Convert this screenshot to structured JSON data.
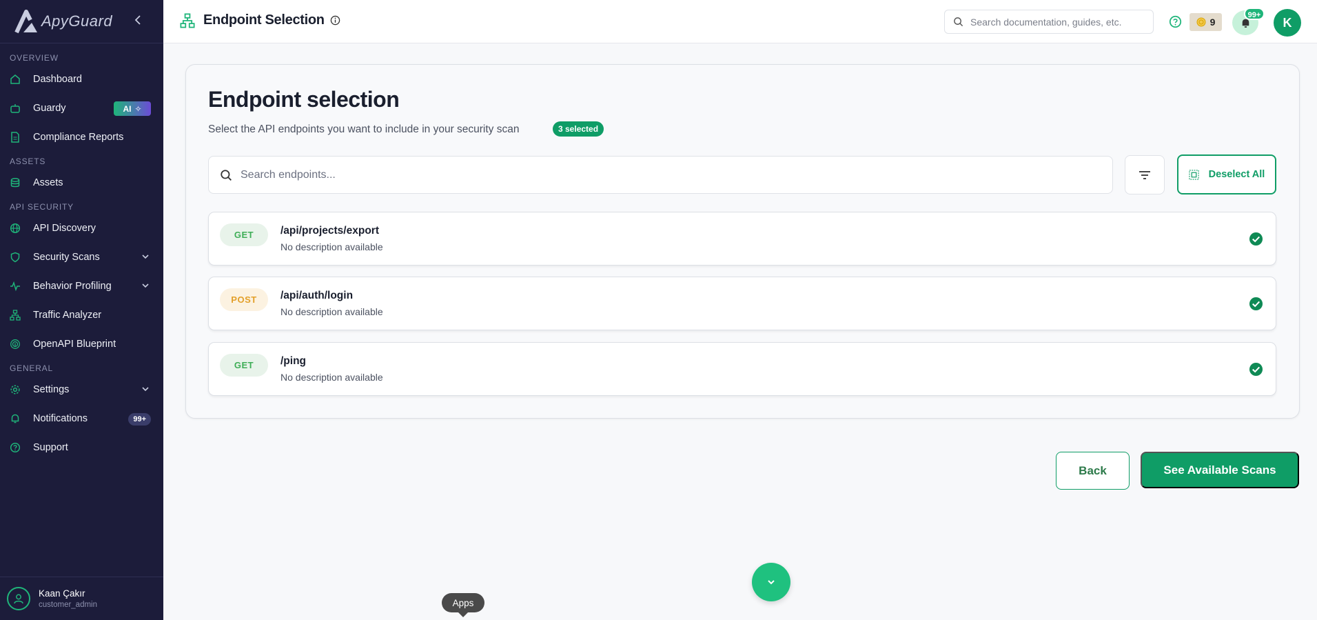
{
  "brand": {
    "name": "ApyGuard"
  },
  "sidebar": {
    "sections": {
      "overview": "OVERVIEW",
      "assets": "ASSETS",
      "api_security": "API SECURITY",
      "general": "GENERAL"
    },
    "items": {
      "dashboard": "Dashboard",
      "guardy": "Guardy",
      "guardy_badge": "AI",
      "compliance": "Compliance Reports",
      "assets": "Assets",
      "api_discovery": "API Discovery",
      "security_scans": "Security Scans",
      "behavior_profiling": "Behavior Profiling",
      "traffic_analyzer": "Traffic Analyzer",
      "openapi_blueprint": "OpenAPI Blueprint",
      "settings": "Settings",
      "notifications": "Notifications",
      "notifications_badge": "99+",
      "support": "Support"
    },
    "user": {
      "name": "Kaan Çakır",
      "role": "customer_admin"
    }
  },
  "header": {
    "title": "Endpoint Selection",
    "search_placeholder": "Search documentation, guides, etc.",
    "credits": "9",
    "notification_badge": "99+",
    "avatar_initial": "K"
  },
  "main": {
    "title": "Endpoint selection",
    "subtitle": "Select the API endpoints you want to include in your security scan",
    "selected_badge": "3 selected",
    "search_placeholder": "Search endpoints...",
    "deselect_label": "Deselect All",
    "endpoints": [
      {
        "method": "GET",
        "path": "/api/projects/export",
        "description": "No description available",
        "selected": true
      },
      {
        "method": "POST",
        "path": "/api/auth/login",
        "description": "No description available",
        "selected": true
      },
      {
        "method": "GET",
        "path": "/ping",
        "description": "No description available",
        "selected": true
      }
    ],
    "back_label": "Back",
    "scans_label": "See Available Scans"
  },
  "overlay": {
    "apps_tooltip": "Apps"
  },
  "colors": {
    "accent": "#0f9d66",
    "sidebar_bg": "#1c1c3a",
    "get": "#3fae57",
    "post": "#e3a02a"
  }
}
